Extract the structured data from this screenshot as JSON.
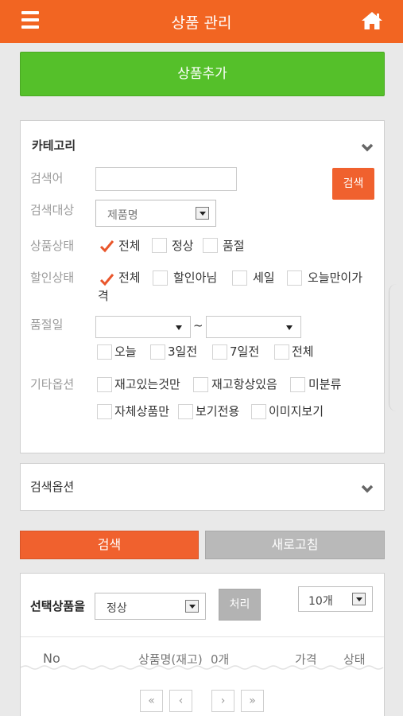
{
  "header": {
    "title": "상품 관리",
    "menu_icon": "hamburger-menu-icon",
    "home_icon": "home-icon"
  },
  "add_product_label": "상품추가",
  "filter": {
    "heading": "카테고리",
    "keyword_label": "검색어",
    "keyword_value": "",
    "search_button": "검색",
    "target_label": "검색대상",
    "target_value": "제품명",
    "product_status": {
      "label": "상품상태",
      "options": [
        {
          "label": "전체",
          "checked": true
        },
        {
          "label": "정상",
          "checked": false
        },
        {
          "label": "품절",
          "checked": false
        }
      ]
    },
    "discount_status": {
      "label": "할인상태",
      "options": [
        {
          "label": "전체",
          "checked": true
        },
        {
          "label": "할인아님",
          "checked": false
        },
        {
          "label": "세일",
          "checked": false
        },
        {
          "label": "오늘만이가",
          "checked": false
        }
      ],
      "wrap_text": "격"
    },
    "soldout": {
      "label": "품절일",
      "range_sep": "~",
      "from_value": "",
      "to_value": "",
      "presets": [
        {
          "label": "오늘",
          "checked": false
        },
        {
          "label": "3일전",
          "checked": false
        },
        {
          "label": "7일전",
          "checked": false
        },
        {
          "label": "전체",
          "checked": false
        }
      ]
    },
    "etc": {
      "label": "기타옵션",
      "options": [
        {
          "label": "재고있는것만",
          "checked": false
        },
        {
          "label": "재고항상있음",
          "checked": false
        },
        {
          "label": "미분류",
          "checked": false
        },
        {
          "label": "자체상품만",
          "checked": false
        },
        {
          "label": "보기전용",
          "checked": false
        },
        {
          "label": "이미지보기",
          "checked": false
        }
      ]
    }
  },
  "search_options_label": "검색옵션",
  "actions": {
    "search": "검색",
    "refresh": "새로고침"
  },
  "list": {
    "selected_label": "선택상품을",
    "status_select_value": "정상",
    "process_button": "처리",
    "page_size_value": "10개",
    "columns": {
      "no": "No",
      "name": "상품명(재고)",
      "count": "0개",
      "price": "가격",
      "status": "상태"
    },
    "pagination": [
      "«",
      "‹",
      "›",
      "»"
    ]
  },
  "colors": {
    "header": "#f26522",
    "add_button": "#55c02a",
    "accent": "#f0612e",
    "refresh_button": "#b9b9b9"
  }
}
